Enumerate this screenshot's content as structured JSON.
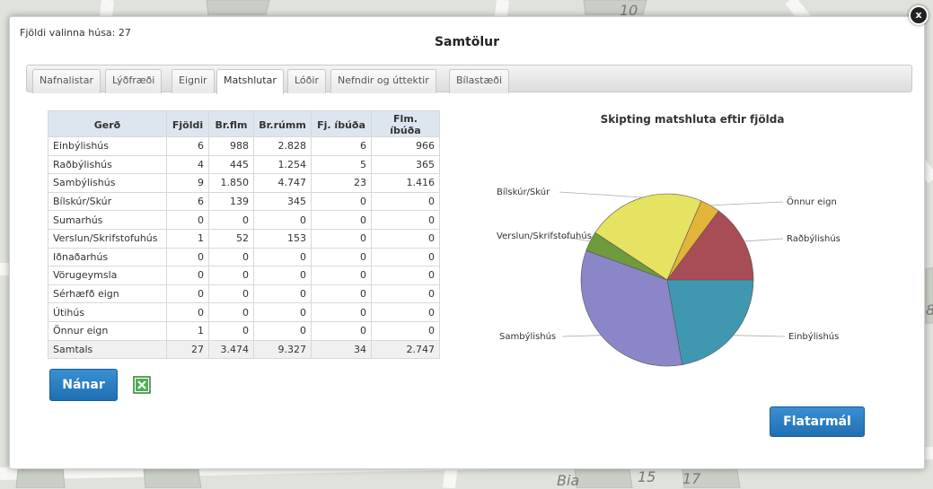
{
  "header": {
    "count_label": "Fjöldi valinna húsa: 27",
    "title": "Samtölur"
  },
  "tabs": [
    {
      "label": "Nafnalistar",
      "active": false
    },
    {
      "label": "Lýðfræði",
      "active": false
    },
    {
      "label": "Eignir",
      "active": false
    },
    {
      "label": "Matshlutar",
      "active": true
    },
    {
      "label": "Lóðir",
      "active": false
    },
    {
      "label": "Nefndir og úttektir",
      "active": false
    },
    {
      "label": "Bílastæði",
      "active": false
    }
  ],
  "table": {
    "columns": [
      "Gerð",
      "Fjöldi",
      "Br.flm",
      "Br.rúmm",
      "Fj. íbúða",
      "Flm. íbúða"
    ],
    "rows": [
      [
        "Einbýlishús",
        "6",
        "988",
        "2.828",
        "6",
        "966"
      ],
      [
        "Raðbýlishús",
        "4",
        "445",
        "1.254",
        "5",
        "365"
      ],
      [
        "Sambýlishús",
        "9",
        "1.850",
        "4.747",
        "23",
        "1.416"
      ],
      [
        "Bílskúr/Skúr",
        "6",
        "139",
        "345",
        "0",
        "0"
      ],
      [
        "Sumarhús",
        "0",
        "0",
        "0",
        "0",
        "0"
      ],
      [
        "Verslun/Skrifstofuhús",
        "1",
        "52",
        "153",
        "0",
        "0"
      ],
      [
        "Iðnaðarhús",
        "0",
        "0",
        "0",
        "0",
        "0"
      ],
      [
        "Vörugeymsla",
        "0",
        "0",
        "0",
        "0",
        "0"
      ],
      [
        "Sérhæfð eign",
        "0",
        "0",
        "0",
        "0",
        "0"
      ],
      [
        "Útihús",
        "0",
        "0",
        "0",
        "0",
        "0"
      ],
      [
        "Önnur eign",
        "1",
        "0",
        "0",
        "0",
        "0"
      ]
    ],
    "total": [
      "Samtals",
      "27",
      "3.474",
      "9.327",
      "34",
      "2.747"
    ]
  },
  "buttons": {
    "details_label": "Nánar",
    "area_label": "Flatarmál",
    "excel_icon": "excel-icon",
    "close_label": "x"
  },
  "map": {
    "labels": [
      "10",
      "15",
      "17",
      "Bia",
      "8"
    ]
  },
  "chart_data": {
    "type": "pie",
    "title": "Skipting matshluta eftir fjölda",
    "slices": [
      {
        "label": "Einbýlishús",
        "value": 6,
        "color": "#3f98b0"
      },
      {
        "label": "Sambýlishús",
        "value": 9,
        "color": "#8a86c8"
      },
      {
        "label": "Verslun/Skrifstofuhús",
        "value": 1,
        "color": "#6f9a3e"
      },
      {
        "label": "Bílskúr/Skúr",
        "value": 6,
        "color": "#e6e262"
      },
      {
        "label": "Önnur eign",
        "value": 1,
        "color": "#e3b43a"
      },
      {
        "label": "Raðbýlishús",
        "value": 4,
        "color": "#a84d55"
      }
    ]
  }
}
